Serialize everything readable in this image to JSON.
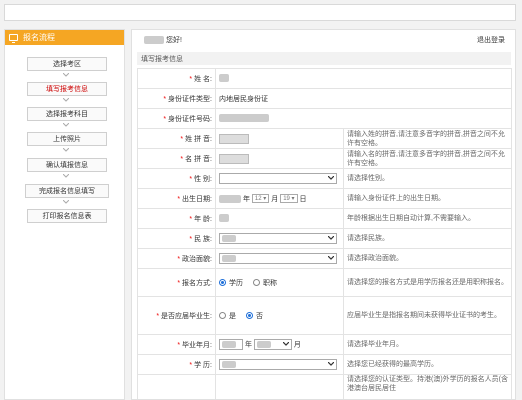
{
  "sidebar": {
    "header": "报名流程",
    "steps": [
      "选择考区",
      "填写报考信息",
      "选择报考科目",
      "上传照片",
      "确认填报信息",
      "完成报名信息填写",
      "打印报名信息表"
    ]
  },
  "header": {
    "greeting": "您好!",
    "logout": "退出登录"
  },
  "section_title": "填写报考信息",
  "form": {
    "name_label": "姓 名:",
    "idtype_label": "身份证件类型:",
    "idtype_value": "内地居民身份证",
    "idnum_label": "身份证件号码:",
    "surname_py_label": "姓 拼 音:",
    "surname_py_hint": "请输入姓的拼音,请注意多音字的拼音,拼音之间不允许有空格。",
    "given_py_label": "名 拼 音:",
    "given_py_hint": "请输入名的拼音,请注意多音字的拼音,拼音之间不允许有空格。",
    "gender_label": "性 别:",
    "gender_hint": "请选择性别。",
    "birth_label": "出生日期:",
    "birth_year_unit": "年",
    "birth_month": "12",
    "birth_month_unit": "月",
    "birth_day": "19",
    "birth_day_unit": "日",
    "birth_hint": "请输入身份证件上的出生日期。",
    "age_label": "年 龄:",
    "age_hint": "年龄根据出生日期自动计算,不需要输入。",
    "ethnic_label": "民 族:",
    "ethnic_hint": "请选择民族。",
    "political_label": "政治面貌:",
    "political_hint": "请选择政治面貌。",
    "apply_mode_label": "报名方式:",
    "apply_mode_opt1": "学历",
    "apply_mode_opt2": "职称",
    "apply_mode_hint": "请选择您的报名方式是用学历报名还是用职称报名。",
    "fresh_grad_label": "是否应届毕业生:",
    "fresh_grad_opt1": "是",
    "fresh_grad_opt2": "否",
    "fresh_grad_hint": "应届毕业生是指报名期间未获得毕业证书的考生。",
    "grad_year_label": "毕业年月:",
    "grad_year_unit": "年",
    "grad_month_unit": "月",
    "grad_year_hint": "请选择毕业年月。",
    "edu_label": "学 历:",
    "edu_hint": "选择您已经获得的最高学历。",
    "last_hint": "请选择您的认证类型。持港(澳)外学历的报名人员(含港澳台居民居住"
  }
}
